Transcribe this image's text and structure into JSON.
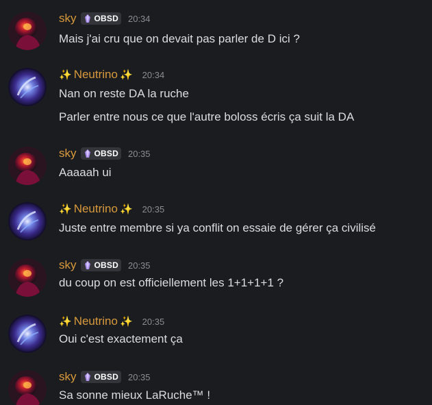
{
  "users": {
    "sky": {
      "name": "sky",
      "badge": "OBSD",
      "name_color": "#d99a3c"
    },
    "neutrino": {
      "name": "Neutrino",
      "sparkle_left": "✨",
      "sparkle_right": "✨",
      "name_color": "#d99a3c"
    }
  },
  "messages": [
    {
      "author": "sky",
      "time": "20:34",
      "lines": [
        "Mais j'ai cru que on devait pas parler de D ici ?"
      ]
    },
    {
      "author": "neutrino",
      "time": "20:34",
      "lines": [
        "Nan on reste DA la ruche",
        "Parler entre nous ce que l'autre boloss écris ça suit la DA"
      ]
    },
    {
      "author": "sky",
      "time": "20:35",
      "lines": [
        "Aaaaah ui"
      ]
    },
    {
      "author": "neutrino",
      "time": "20:35",
      "lines": [
        "Juste entre membre si ya conflit on essaie de gérer ça civilisé"
      ]
    },
    {
      "author": "sky",
      "time": "20:35",
      "lines": [
        "du coup on est officiellement les 1+1+1+1 ?"
      ]
    },
    {
      "author": "neutrino",
      "time": "20:35",
      "lines": [
        "Oui c'est exactement ça"
      ]
    },
    {
      "author": "sky",
      "time": "20:35",
      "lines": [
        "Sa sonne mieux LaRuche™ !"
      ]
    }
  ],
  "colors": {
    "background": "#1b1c20",
    "text": "#dcdde1",
    "timestamp": "#8b8d94",
    "tag_bg": "#34353b"
  }
}
